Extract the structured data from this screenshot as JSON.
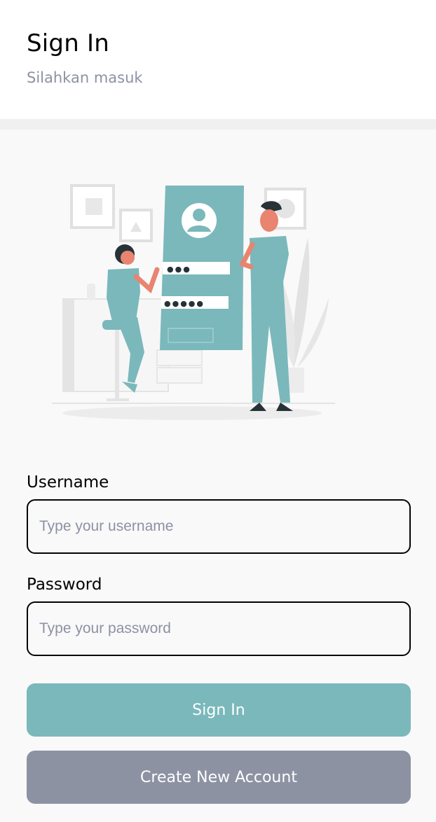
{
  "header": {
    "title": "Sign In",
    "subtitle": "Silahkan masuk"
  },
  "illustration": {
    "icon": "login-illustration",
    "password_dots_short": "●●●",
    "password_dots_long": "●●●●●"
  },
  "form": {
    "username": {
      "label": "Username",
      "placeholder": "Type your username",
      "value": ""
    },
    "password": {
      "label": "Password",
      "placeholder": "Type your password",
      "value": ""
    }
  },
  "buttons": {
    "sign_in": "Sign In",
    "create_account": "Create New Account"
  },
  "colors": {
    "primary": "#7ab8bb",
    "secondary": "#8d92a3",
    "text": "#020202",
    "background": "#f9f9f9"
  }
}
